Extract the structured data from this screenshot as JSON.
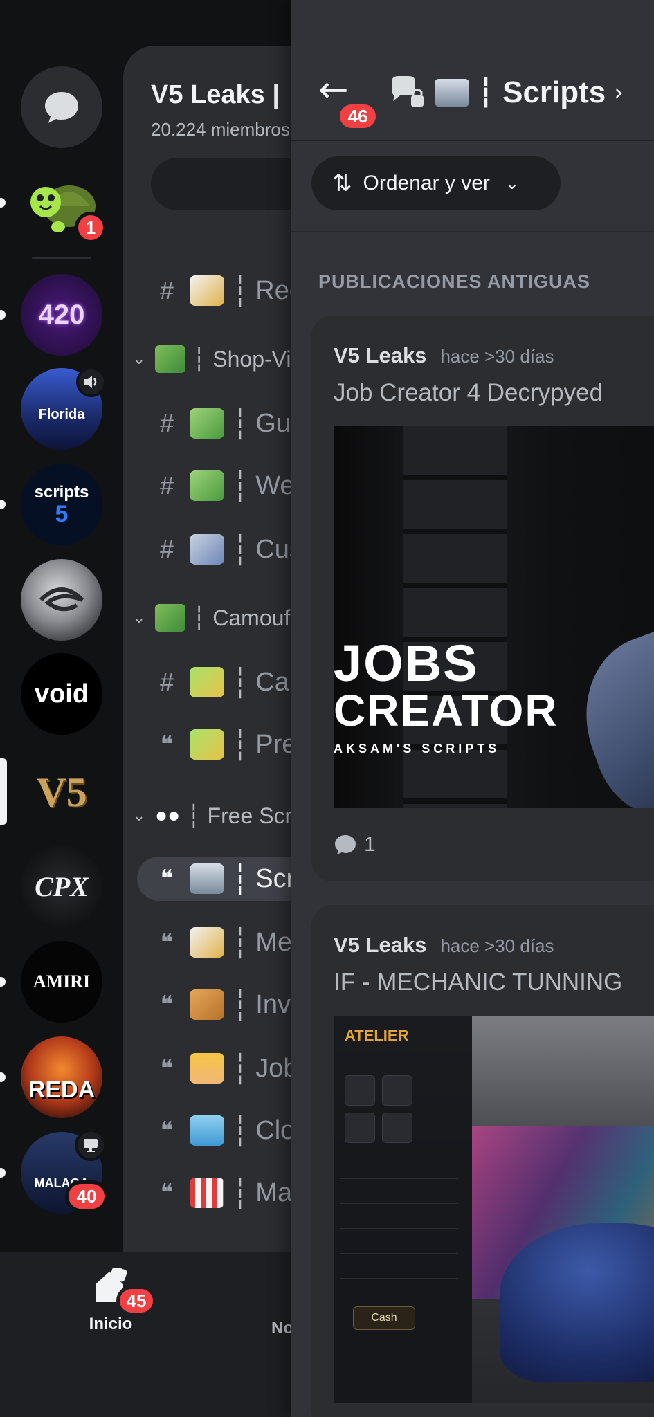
{
  "rail": {
    "servers": [
      {
        "id": "dm",
        "kind": "dm"
      },
      {
        "id": "turtle",
        "badge": "1"
      },
      {
        "id": "420",
        "label": "420"
      },
      {
        "id": "florida",
        "label": "Florida"
      },
      {
        "id": "5scripts",
        "label": "scripts"
      },
      {
        "id": "swirl",
        "label": ""
      },
      {
        "id": "void",
        "label": "void"
      },
      {
        "id": "v5",
        "label": "V5"
      },
      {
        "id": "cpx",
        "label": "CPX"
      },
      {
        "id": "amiri",
        "label": "AMIRI"
      },
      {
        "id": "reda",
        "label": "REDA"
      },
      {
        "id": "malaga",
        "label": "MALAGA",
        "badge": "40"
      }
    ]
  },
  "channel_panel": {
    "server_name": "V5 Leaks |",
    "members": "20.224 miembros",
    "channels": [
      {
        "type": "text",
        "name": "Rec"
      },
      {
        "type": "category",
        "name": "Shop-Vip"
      },
      {
        "type": "text",
        "name": "Gun"
      },
      {
        "type": "text",
        "name": "Wea"
      },
      {
        "type": "text",
        "name": "Cus"
      },
      {
        "type": "category",
        "name": "Camoufl"
      },
      {
        "type": "text",
        "name": "Car"
      },
      {
        "type": "forum",
        "name": "Pre"
      },
      {
        "type": "category",
        "name": "Free Scri"
      },
      {
        "type": "forum",
        "name": "Scr",
        "active": true
      },
      {
        "type": "forum",
        "name": "Mer"
      },
      {
        "type": "forum",
        "name": "Inv"
      },
      {
        "type": "forum",
        "name": "Job"
      },
      {
        "type": "forum",
        "name": "Clo"
      },
      {
        "type": "forum",
        "name": "Map"
      }
    ]
  },
  "bottom_nav": {
    "home_label": "Inicio",
    "home_badge": "45",
    "next_label": "No"
  },
  "forum": {
    "back_badge": "46",
    "channel_name": "Scripts",
    "sort_label": "Ordenar y ver",
    "section_title": "PUBLICACIONES ANTIGUAS",
    "posts": [
      {
        "author": "V5 Leaks",
        "time": "hace >30 días",
        "title": "Job Creator 4 Decrypyed",
        "comments": "1",
        "image_text": {
          "line1": "JOBS",
          "line2": "CREATOR",
          "line3": "AKSAM'S SCRIPTS"
        }
      },
      {
        "author": "V5 Leaks",
        "time": "hace >30 días",
        "title": "IF - MECHANIC TUNNING",
        "image_text": {
          "title": "ATELIER",
          "button": "Cash"
        }
      }
    ]
  },
  "colors": {
    "rail_bg": "#111214",
    "panel_bg": "#2b2d31",
    "forum_bg": "#313338",
    "badge": "#f23f42",
    "text": "#f2f3f5",
    "muted": "#949ba4"
  }
}
